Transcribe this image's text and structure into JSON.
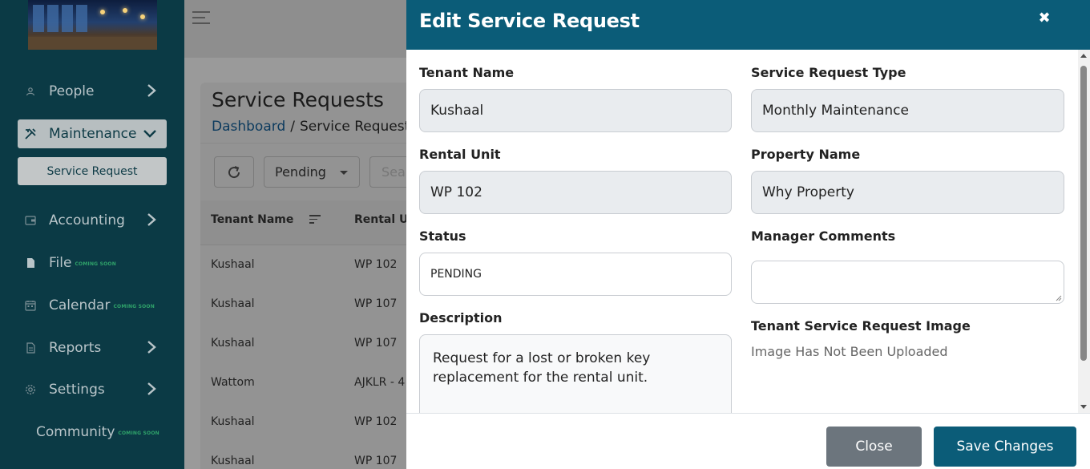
{
  "sidebar": {
    "items": [
      {
        "label": "People",
        "icon": "person-icon"
      },
      {
        "label": "Maintenance",
        "icon": "tools-icon"
      },
      {
        "label": "Accounting",
        "icon": "wallet-icon"
      },
      {
        "label": "File",
        "icon": "file-icon",
        "badge": "COMING SOON"
      },
      {
        "label": "Calendar",
        "icon": "calendar-icon",
        "badge": "COMING SOON"
      },
      {
        "label": "Reports",
        "icon": "report-icon"
      },
      {
        "label": "Settings",
        "icon": "gear-icon"
      }
    ],
    "sub_item": "Service Request",
    "community": {
      "label": "Community",
      "badge": "COMING SOON"
    }
  },
  "main": {
    "title": "Service Requests",
    "breadcrumb": {
      "home": "Dashboard",
      "separator": "/",
      "current": "Service Requests"
    },
    "filter_value": "Pending",
    "search_placeholder": "Search",
    "columns": [
      "Tenant Name",
      "Rental Unit"
    ],
    "rows": [
      [
        "Kushaal",
        "WP 102"
      ],
      [
        "Kushaal",
        "WP 107"
      ],
      [
        "Kushaal",
        "WP 107"
      ],
      [
        "Wattom",
        "AJKLR - 4"
      ],
      [
        "Kushaal",
        "WP 102"
      ],
      [
        "Kushaal",
        "WP 107"
      ]
    ]
  },
  "modal": {
    "title": "Edit Service Request",
    "fields": {
      "tenant_name": {
        "label": "Tenant Name",
        "value": "Kushaal"
      },
      "service_request_type": {
        "label": "Service Request Type",
        "value": "Monthly Maintenance"
      },
      "rental_unit": {
        "label": "Rental Unit",
        "value": "WP 102"
      },
      "property_name": {
        "label": "Property Name",
        "value": "Why Property"
      },
      "status": {
        "label": "Status",
        "value": "PENDING"
      },
      "manager_comments": {
        "label": "Manager Comments",
        "value": ""
      },
      "description": {
        "label": "Description",
        "value": "Request for a lost or broken key replacement for the rental unit."
      },
      "image": {
        "label": "Tenant Service Request Image",
        "value": "Image Has Not Been Uploaded"
      }
    },
    "buttons": {
      "close": "Close",
      "save": "Save Changes"
    }
  },
  "colors": {
    "sidebar": "#0b3a45",
    "header": "#0b5c78",
    "secondary": "#6c757d",
    "soon": "#2fa36a"
  }
}
